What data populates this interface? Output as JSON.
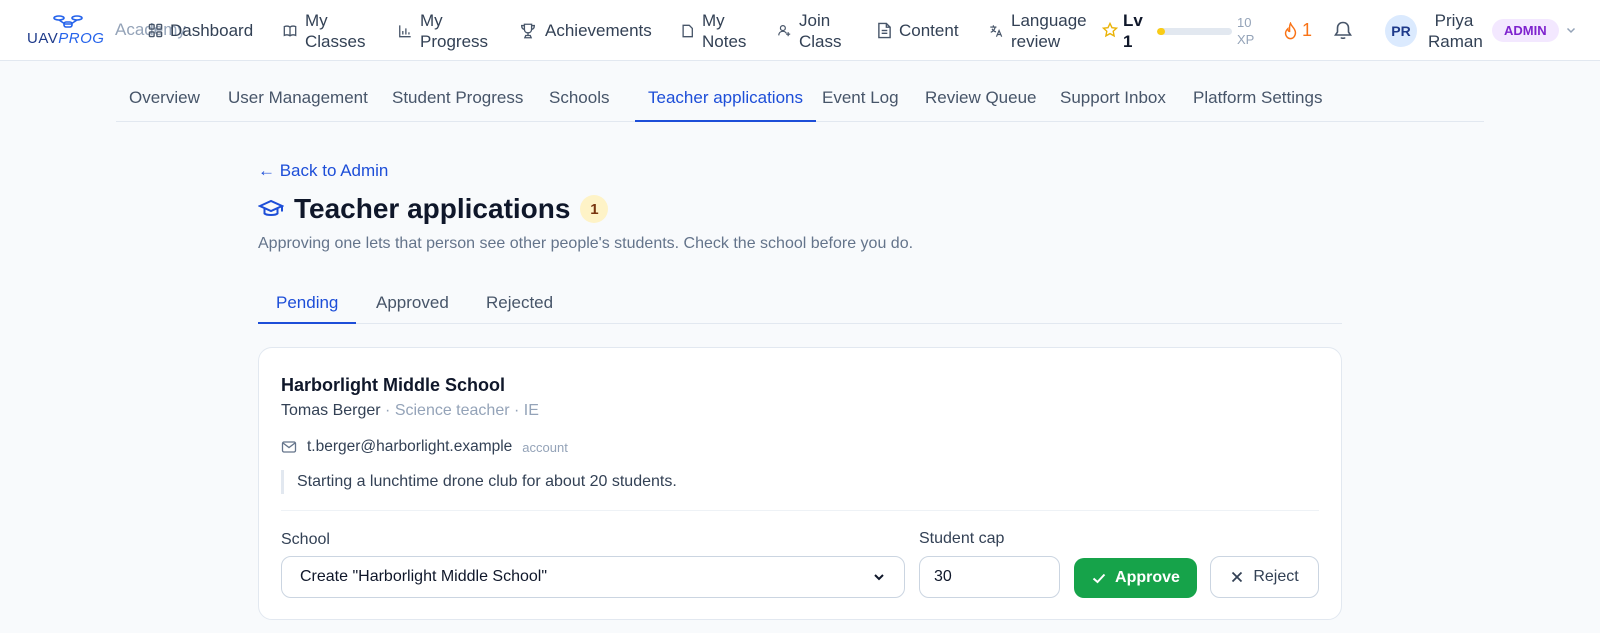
{
  "app": {
    "logo_prefix": "UAV",
    "logo_suffix": "PROG",
    "logo_sub": "Academy"
  },
  "nav": {
    "items": [
      {
        "label": "Dashboard",
        "icon": "dashboard-grid-icon"
      },
      {
        "label": "My Classes",
        "icon": "book-open-icon"
      },
      {
        "label": "My Progress",
        "icon": "bar-chart-icon"
      },
      {
        "label": "Achievements",
        "icon": "trophy-icon"
      },
      {
        "label": "My Notes",
        "icon": "note-icon"
      },
      {
        "label": "Join Class",
        "icon": "user-plus-icon"
      },
      {
        "label": "Content",
        "icon": "document-icon"
      },
      {
        "label": "Language review",
        "icon": "translate-icon"
      }
    ]
  },
  "gamification": {
    "level_label": "Lv 1",
    "xp_label": "10 XP",
    "xp_progress": 0.1,
    "streak": "1"
  },
  "user": {
    "initials": "PR",
    "name": "Priya Raman",
    "role_badge": "ADMIN"
  },
  "admin_tabs": [
    "Overview",
    "User Management",
    "Student Progress",
    "Schools",
    "Teacher applications",
    "Event Log",
    "Review Queue",
    "Support Inbox",
    "Platform Settings"
  ],
  "admin_tab_active": "Teacher applications",
  "page": {
    "back_link": "← Back to Admin",
    "title": "Teacher applications",
    "count": "1",
    "subtitle": "Approving one lets that person see other people's students. Check the school before you do."
  },
  "status_tabs": [
    "Pending",
    "Approved",
    "Rejected"
  ],
  "status_tab_active": "Pending",
  "application": {
    "school": "Harborlight Middle School",
    "applicant_name": "Tomas Berger",
    "applicant_meta": " · Science teacher · IE",
    "email": "t.berger@harborlight.example",
    "email_tag": "account",
    "note": "Starting a lunchtime drone club for about 20 students.",
    "school_field_label": "School",
    "school_select_value": "Create \"Harborlight Middle School\"",
    "cap_field_label": "Student cap",
    "cap_value": "30",
    "approve_label": "Approve",
    "reject_label": "Reject"
  },
  "colors": {
    "accent": "#1d4ed8",
    "approve": "#16a34a",
    "admin_badge_bg": "#f3e8ff",
    "admin_badge_text": "#7e22ce",
    "streak": "#f97316",
    "xp_fill": "#facc15"
  }
}
